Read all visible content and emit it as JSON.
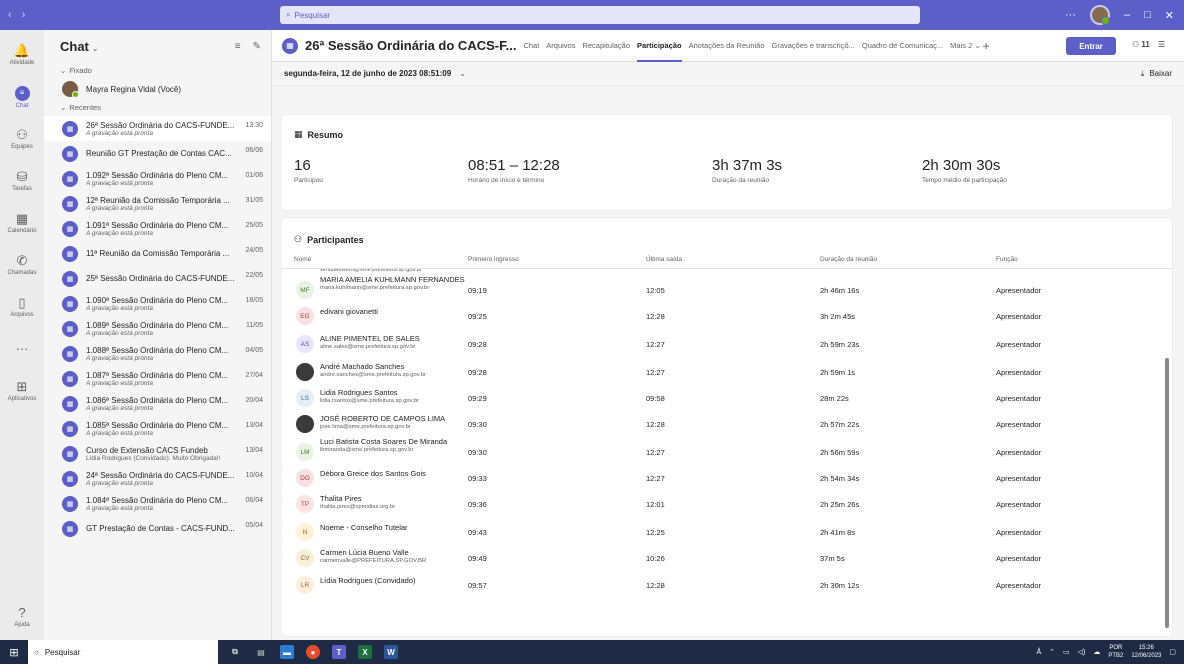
{
  "titlebar": {
    "back_icon": "chevron-left-icon",
    "forward_icon": "chevron-right-icon",
    "search_placeholder": "Pesquisar",
    "more_label": "···",
    "minimize_label": "–",
    "maximize_label": "□",
    "close_label": "✕"
  },
  "rail": [
    {
      "label": "Atividade",
      "icon": "bell-icon",
      "glyph": "🔔"
    },
    {
      "label": "Chat",
      "icon": "chat-icon",
      "glyph": "≡",
      "active": true
    },
    {
      "label": "Equipes",
      "icon": "teams-icon",
      "glyph": "⚇"
    },
    {
      "label": "Tarefas",
      "icon": "tasks-icon",
      "glyph": "⛁"
    },
    {
      "label": "Calendário",
      "icon": "calendar-icon",
      "glyph": "▦"
    },
    {
      "label": "Chamadas",
      "icon": "phone-icon",
      "glyph": "✆"
    },
    {
      "label": "Arquivos",
      "icon": "file-icon",
      "glyph": "▯"
    },
    {
      "label": "",
      "icon": "more-icon",
      "glyph": "···"
    },
    {
      "label": "Aplicativos",
      "icon": "apps-icon",
      "glyph": "⊞"
    }
  ],
  "rail_help": {
    "label": "Ajuda",
    "glyph": "?"
  },
  "chatpane": {
    "title": "Chat",
    "fixed_label": "Fixado",
    "recent_label": "Recentes",
    "pinned": [
      {
        "name": "Mayra Regina Vidal (Você)"
      }
    ],
    "recent": [
      {
        "name": "26ª Sessão Ordinária do CACS-FUNDE...",
        "sub": "A gravação está pronta",
        "date": "13:30",
        "selected": true
      },
      {
        "name": "Reunião GT Prestação de Contas CAC...",
        "sub": "",
        "date": "06/06"
      },
      {
        "name": "1.092ª Sessão Ordinária do Pleno CM...",
        "sub": "A gravação está pronta",
        "date": "01/06"
      },
      {
        "name": "12ª Reunião da Comissão Temporária ...",
        "sub": "A gravação está pronta",
        "date": "31/05"
      },
      {
        "name": "1.091ª Sessão Ordinária do Pleno CM...",
        "sub": "A gravação está pronta",
        "date": "25/05"
      },
      {
        "name": "11ª Reunião da Comissão Temporária ...",
        "sub": "",
        "date": "24/05"
      },
      {
        "name": "25ª Sessão Ordinária do CACS-FUNDE...",
        "sub": "",
        "date": "22/05"
      },
      {
        "name": "1.090ª Sessão Ordinária do Pleno CM...",
        "sub": "A gravação está pronta",
        "date": "18/05"
      },
      {
        "name": "1.089ª Sessão Ordinária do Pleno CM...",
        "sub": "A gravação está pronta",
        "date": "11/05"
      },
      {
        "name": "1.088ª Sessão Ordinária do Pleno CM...",
        "sub": "A gravação está pronta",
        "date": "04/05"
      },
      {
        "name": "1.087ª Sessão Ordinária do Pleno CM...",
        "sub": "A gravação está pronta",
        "date": "27/04"
      },
      {
        "name": "1.086ª Sessão Ordinária do Pleno CM...",
        "sub": "A gravação está pronta",
        "date": "20/04"
      },
      {
        "name": "1.085ª Sessão Ordinária do Pleno CM...",
        "sub": "A gravação está pronta",
        "date": "13/04"
      },
      {
        "name": "Curso de Extensão CACS Fundeb",
        "sub": "Lídia Rodrigues (Convidado): Muito Obrigada!!",
        "date": "13/04",
        "plain": true
      },
      {
        "name": "24ª Sessão Ordinária do CACS-FUNDE...",
        "sub": "A gravação está pronta",
        "date": "10/04"
      },
      {
        "name": "1.084ª Sessão Ordinária do Pleno CM...",
        "sub": "A gravação está pronta",
        "date": "06/04"
      },
      {
        "name": "GT Prestação de Contas - CACS-FUND...",
        "sub": "",
        "date": "05/04"
      }
    ]
  },
  "meeting": {
    "title": "26ª Sessão Ordinária do CACS-F...",
    "tabs": [
      {
        "label": "Chat"
      },
      {
        "label": "Arquivos"
      },
      {
        "label": "Recapitulação"
      },
      {
        "label": "Participação",
        "active": true
      },
      {
        "label": "Anotações da Reunião"
      },
      {
        "label": "Gravações e transcriçõ..."
      },
      {
        "label": "Quadro de Comunicaç..."
      },
      {
        "label": "Mais 2 ⌄"
      }
    ],
    "join_label": "Entrar",
    "people_count": "11",
    "date_label": "segunda-feira, 12 de junho de 2023 08:51:09",
    "download_label": "Baixar"
  },
  "summary": {
    "title": "Resumo",
    "stats": [
      {
        "value": "16",
        "label": "Participou"
      },
      {
        "value": "08:51 – 12:28",
        "label": "Horário de início e término"
      },
      {
        "value": "3h 37m 3s",
        "label": "Duração da reunião"
      },
      {
        "value": "2h 30m 30s",
        "label": "Tempo médio de participação"
      }
    ]
  },
  "participants": {
    "title": "Participantes",
    "columns": [
      "Nome",
      "Primeiro ingresso",
      "Última saída",
      "Duração da reunião",
      "Função"
    ],
    "partial_mail": "simbiaelviero@sme.prefeitura.sp.gov.br",
    "rows": [
      {
        "initials": "MF",
        "name": "MARIA AMELIA KUHLMANN FERNANDES",
        "email": "maria.kuhlmann@sme.prefeitura.sp.gov.br",
        "first": "09:19",
        "last": "12:05",
        "duration": "2h 46m 16s",
        "role": "Apresentador",
        "bg": "#e8f3e3",
        "fg": "#4a7a3a"
      },
      {
        "initials": "EG",
        "name": "edivani giovanetti",
        "email": "",
        "first": "09:25",
        "last": "12:28",
        "duration": "3h 2m 45s",
        "role": "Apresentador",
        "bg": "#f9e1e1",
        "fg": "#a4373a"
      },
      {
        "initials": "AS",
        "name": "ALINE PIMENTEL DE SALES",
        "email": "aline.sales@sme.prefeitura.sp.gov.br",
        "first": "09:28",
        "last": "12:27",
        "duration": "2h 59m 23s",
        "role": "Apresentador",
        "bg": "#e6e7f7",
        "fg": "#4f52b2"
      },
      {
        "initials": "",
        "name": "André Machado Sanches",
        "email": "andre.sanches@sme.prefeitura.sp.gov.br",
        "first": "09:28",
        "last": "12:27",
        "duration": "2h 59m 1s",
        "role": "Apresentador",
        "photo": true
      },
      {
        "initials": "LS",
        "name": "Lidia Rodrigues Santos",
        "email": "lidia.rsantos@sme.prefeitura.sp.gov.br",
        "first": "09:29",
        "last": "09:58",
        "duration": "28m 22s",
        "role": "Apresentador",
        "bg": "#e3eef7",
        "fg": "#3a6a92"
      },
      {
        "initials": "",
        "name": "JOSÉ ROBERTO DE CAMPOS LIMA",
        "email": "jose.lima@sme.prefeitura.sp.gov.br",
        "first": "09:30",
        "last": "12:28",
        "duration": "2h 57m 22s",
        "role": "Apresentador",
        "photo": true
      },
      {
        "initials": "LM",
        "name": "Luci Batista Costa Soares De Miranda",
        "email": "lbmiranda@sme.prefeitura.sp.gov.br",
        "first": "09:30",
        "last": "12:27",
        "duration": "2h 56m 59s",
        "role": "Apresentador",
        "bg": "#e8f3e3",
        "fg": "#4a7a3a"
      },
      {
        "initials": "DG",
        "name": "Débora Greice dos Santos Gois",
        "email": "",
        "first": "09:33",
        "last": "12:27",
        "duration": "2h 54m 34s",
        "role": "Apresentador",
        "bg": "#f9e1e1",
        "fg": "#a4373a"
      },
      {
        "initials": "TP",
        "name": "Thalita Pires",
        "email": "thalita.pires@cpmidias.org.br",
        "first": "09:36",
        "last": "12:01",
        "duration": "2h 25m 26s",
        "role": "Apresentador",
        "bg": "#fbe3e3",
        "fg": "#b34a4a"
      },
      {
        "initials": "N",
        "name": "Noeme - Conselho Tutelar",
        "email": "",
        "first": "09:43",
        "last": "12:25",
        "duration": "2h 41m 8s",
        "role": "Apresentador",
        "bg": "#fdf1d8",
        "fg": "#8a6a1f"
      },
      {
        "initials": "CV",
        "name": "Carmen Lúcia Bueno Valle",
        "email": "carmenvalle@PREFEITURA.SP.GOV.BR",
        "first": "09:49",
        "last": "10:26",
        "duration": "37m 5s",
        "role": "Apresentador",
        "bg": "#f8f0d8",
        "fg": "#8a6a1f"
      },
      {
        "initials": "LR",
        "name": "Lídia Rodrigues (Convidado)",
        "email": "",
        "first": "09:57",
        "last": "12:28",
        "duration": "2h 30m 12s",
        "role": "Apresentador",
        "bg": "#fdeedd",
        "fg": "#a4622a"
      }
    ]
  },
  "taskbar": {
    "search_placeholder": "Pesquisar",
    "lang": "POR",
    "layout": "PTB2",
    "time": "15:26",
    "date": "12/06/2023"
  }
}
